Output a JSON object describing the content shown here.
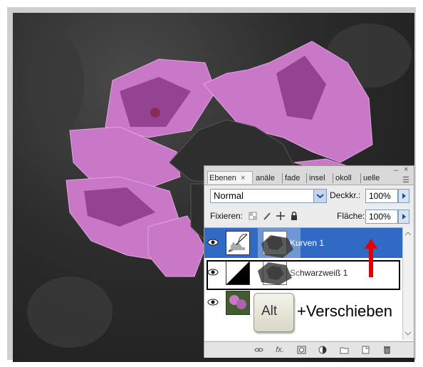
{
  "panel": {
    "tabs": [
      "Ebenen",
      "anäle",
      "fade",
      "insel",
      "okoll",
      "uelle"
    ],
    "tab_close": "×",
    "blend_mode": "Normal",
    "opacity_label": "Deckkr.:",
    "opacity_value": "100%",
    "lock_label": "Fixieren:",
    "fill_label": "Fläche:",
    "fill_value": "100%",
    "layers": [
      {
        "name": "Kurven 1",
        "selected": true
      },
      {
        "name": "Schwarzweiß 1",
        "selected": false
      },
      {
        "name": "",
        "selected": false
      }
    ],
    "footer_icons": [
      "link-icon",
      "fx-icon",
      "mask-icon",
      "adjustment-icon",
      "folder-icon",
      "new-layer-icon",
      "trash-icon"
    ],
    "fx_label": "fx."
  },
  "overlay": {
    "key_label": "Alt",
    "hint_text": "+Verschieben"
  },
  "colors": {
    "selection_blue": "#316ac5",
    "arrow_red": "#e00000",
    "flower_pink": "#c978c8"
  }
}
